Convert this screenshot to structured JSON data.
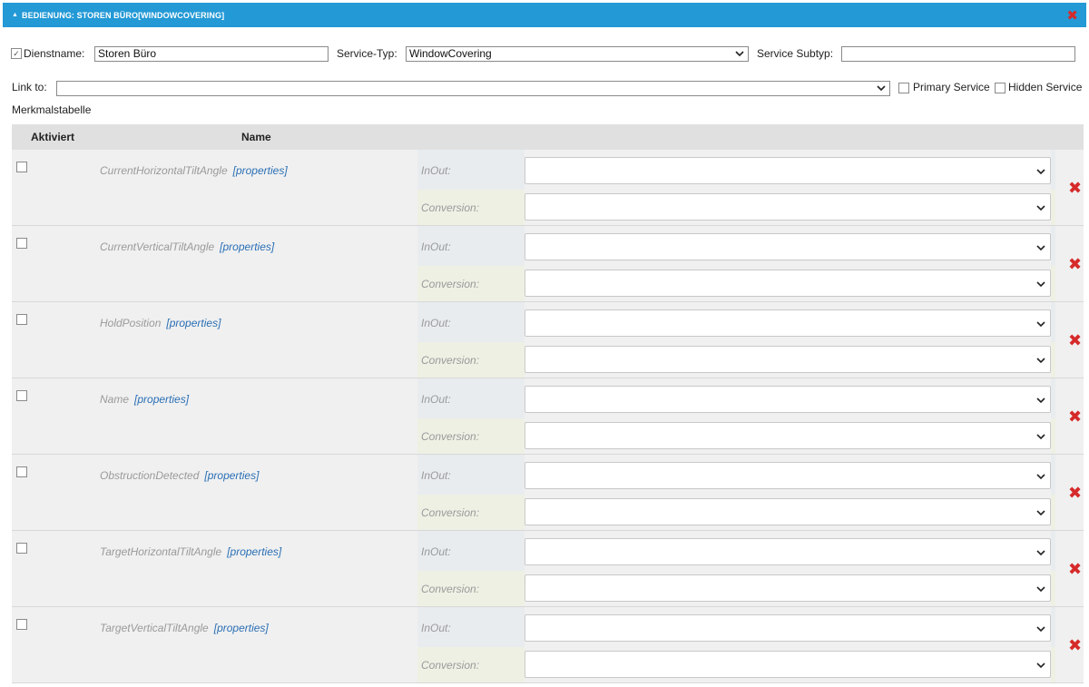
{
  "header": {
    "title": "BEDIENUNG: STOREN BÜRO[WINDOWCOVERING]",
    "collapse_icon": "triangle-icon",
    "close_icon": "close-icon",
    "close_glyph": "✖",
    "collapse_glyph": "▲"
  },
  "form": {
    "service_name_label": "Dienstname:",
    "service_name_checked": true,
    "service_name_value": "Storen Büro",
    "service_type_label": "Service-Typ:",
    "service_type_value": "WindowCovering",
    "service_subtype_label": "Service Subtyp:",
    "service_subtype_value": "",
    "link_to_label": "Link to:",
    "link_to_value": "",
    "primary_service_label": "Primary Service",
    "hidden_service_label": "Hidden Service"
  },
  "table": {
    "caption": "Merkmalstabelle",
    "col_activated": "Aktiviert",
    "col_name": "Name",
    "inout_label": "InOut:",
    "conversion_label": "Conversion:",
    "properties_link": "[properties]",
    "delete_glyph": "✖",
    "rows": [
      {
        "name": "CurrentHorizontalTiltAngle"
      },
      {
        "name": "CurrentVerticalTiltAngle"
      },
      {
        "name": "HoldPosition"
      },
      {
        "name": "Name"
      },
      {
        "name": "ObstructionDetected"
      },
      {
        "name": "TargetHorizontalTiltAngle"
      },
      {
        "name": "TargetVerticalTiltAngle"
      }
    ]
  },
  "colors": {
    "accent": "#2399d6",
    "delete": "#d62a2a",
    "link": "#2a6fb5"
  }
}
